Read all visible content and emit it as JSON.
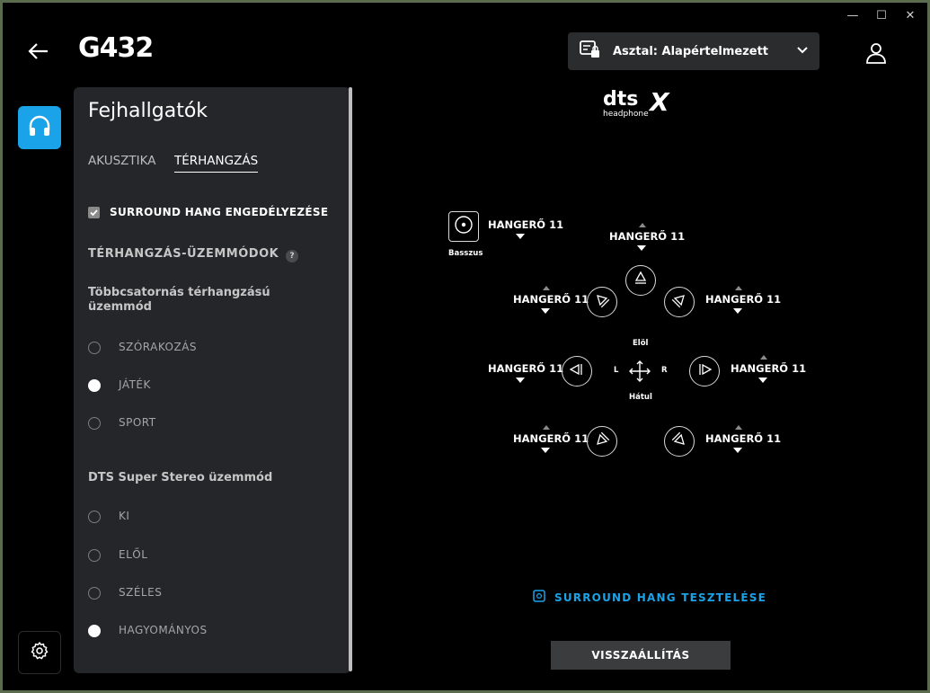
{
  "window": {
    "minimize": "—",
    "maximize": "☐",
    "close": "✕"
  },
  "header": {
    "title": "G432",
    "profile_label": "Asztal: Alapértelmezett"
  },
  "panel": {
    "title": "Fejhallgatók",
    "tabs": [
      {
        "label": "AKUSZTIKA",
        "active": false
      },
      {
        "label": "TÉRHANGZÁS",
        "active": true
      }
    ],
    "surround_checkbox": {
      "label": "SURROUND HANG ENGEDÉLYEZÉSE",
      "checked": true
    },
    "modes_header": "TÉRHANGZÁS-ÜZEMMÓDOK",
    "help": "?",
    "multichannel": {
      "heading": "Többcsatornás térhangzású üzemmód",
      "options": [
        {
          "label": "SZÓRAKOZÁS",
          "selected": false
        },
        {
          "label": "JÁTÉK",
          "selected": true
        },
        {
          "label": "SPORT",
          "selected": false
        }
      ]
    },
    "stereo": {
      "heading": "DTS Super Stereo üzemmód",
      "options": [
        {
          "label": "KI",
          "selected": false
        },
        {
          "label": "ELŐL",
          "selected": false
        },
        {
          "label": "SZÉLES",
          "selected": false
        },
        {
          "label": "HAGYOMÁNYOS",
          "selected": true
        }
      ]
    }
  },
  "logo": {
    "main": "dts",
    "x": "X",
    "sub": "headphone"
  },
  "speakers": {
    "bass_label": "Basszus",
    "front_label": "Elöl",
    "back_label": "Hátul",
    "left_label": "L",
    "right_label": "R",
    "volume_text": {
      "bass": "HANGERŐ 11",
      "center": "HANGERŐ 11",
      "front_left": "HANGERŐ 11",
      "front_right": "HANGERŐ 11",
      "side_left": "HANGERŐ 11",
      "side_right": "HANGERŐ 11",
      "rear_left": "HANGERŐ 11",
      "rear_right": "HANGERŐ 11"
    }
  },
  "test_label": "SURROUND HANG TESZTELÉSE",
  "reset_label": "VISSZAÁLLÍTÁS",
  "colors": {
    "accent": "#1aa3e8",
    "panel": "#25262a",
    "background": "#000000"
  }
}
